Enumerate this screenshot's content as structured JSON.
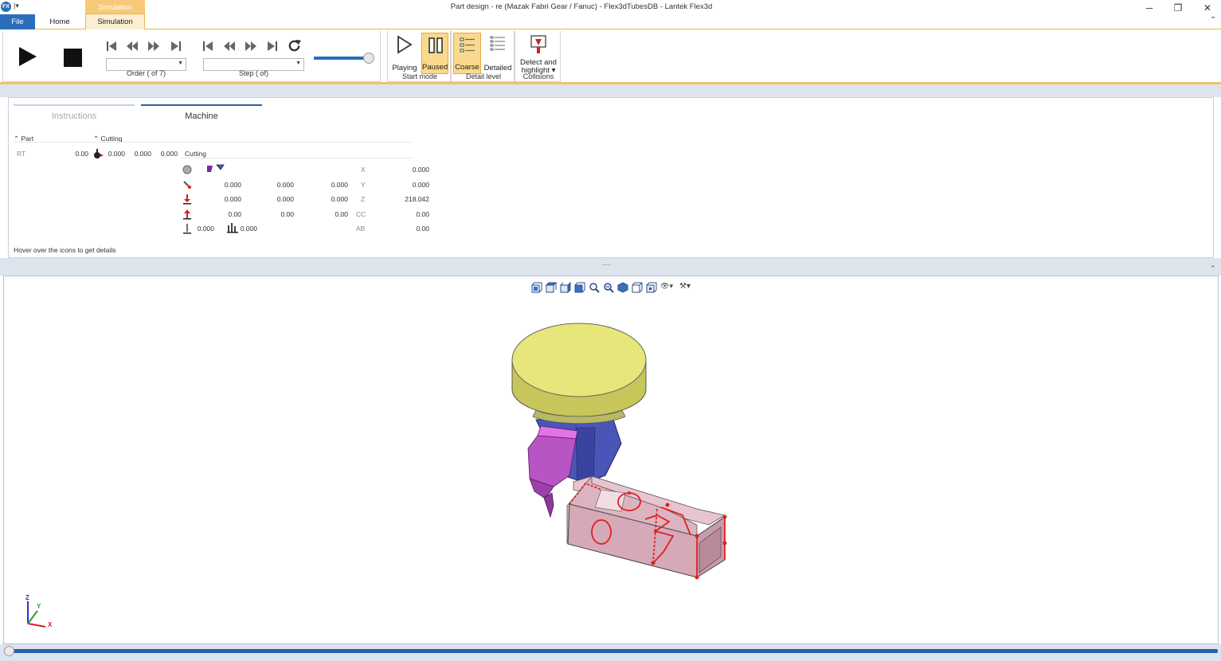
{
  "window": {
    "title": "Part design - re (Mazak Fabri Gear / Fanuc) - Flex3dTubesDB - Lantek Flex3d",
    "app_logo": "FX",
    "minimize": "─",
    "restore": "❐",
    "close": "✕",
    "collapse": "⌃"
  },
  "tabs": {
    "file": "File",
    "home": "Home",
    "context_group": "Simulation",
    "simulation": "Simulation"
  },
  "ribbon": {
    "order_label": "Order ( of 7)",
    "step_label": "Step ( of)",
    "order_value": "",
    "step_value": "",
    "speed_fraction": 0.92,
    "start_mode": {
      "label": "Start mode",
      "playing": "Playing",
      "paused": "Paused",
      "active": "paused"
    },
    "detail_level": {
      "label": "Detail level",
      "coarse": "Coarse",
      "detailed": "Detailed",
      "active": "coarse"
    },
    "collisions": {
      "label": "Collisions",
      "detect_line1": "Detect and",
      "detect_line2": "highlight ▾"
    }
  },
  "panel": {
    "tabs": {
      "instructions": "Instructions",
      "machine": "Machine",
      "active": "machine"
    },
    "part_header": "Part",
    "cutting_header": "Cutting",
    "rt_label": "RT",
    "rt_value": "0.00",
    "rt_coords": [
      "0.000",
      "0.000",
      "0.000"
    ],
    "cutting_value": "Cutting",
    "rows": [
      {
        "icon": "circle-icon",
        "v1": "",
        "v2": "",
        "v3": "",
        "axis": "X",
        "axis_value": "0.000"
      },
      {
        "icon": "tool-icon",
        "v1": "0.000",
        "v2": "0.000",
        "v3": "0.000",
        "axis": "Y",
        "axis_value": "0.000"
      },
      {
        "icon": "arrow-down-icon",
        "v1": "0.000",
        "v2": "0.000",
        "v3": "0.000",
        "axis": "Z",
        "axis_value": "218.042"
      },
      {
        "icon": "arrow-up-icon",
        "v1": "0.00",
        "v2": "0.00",
        "v3": "0.00",
        "axis": "CC",
        "axis_value": "0.00"
      },
      {
        "icon": "height-icon",
        "v1": "0.000",
        "v2": "",
        "v3": "",
        "axis": "AB",
        "axis_value": "0.00",
        "extra": "0.000"
      }
    ],
    "hint": "Hover over the icons to get details"
  },
  "splitter_grip": "·······",
  "viewport": {
    "axis_z": "Z",
    "axis_y": "Y",
    "axis_x": "X"
  },
  "colors": {
    "accent": "#2a6ebb",
    "ribbon_active": "#fbd98c",
    "head_yellow": "#e8e87a",
    "head_blue": "#4a55b8",
    "head_magenta": "#b854c4",
    "tube_pink": "#e8c0cc",
    "cut_red": "#e02020"
  }
}
